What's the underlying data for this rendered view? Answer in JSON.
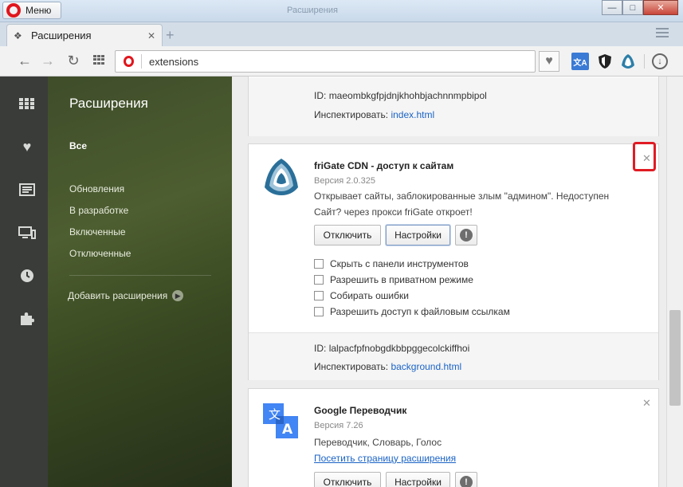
{
  "window": {
    "menu_label": "Меню",
    "title": "Расширения"
  },
  "tab": {
    "label": "Расширения"
  },
  "toolbar": {
    "address": "extensions"
  },
  "sidebar": {
    "title": "Расширения",
    "items": [
      {
        "label": "Все",
        "active": true
      },
      {
        "label": "Обновления"
      },
      {
        "label": "В разработке"
      },
      {
        "label": "Включенные"
      },
      {
        "label": "Отключенные"
      }
    ],
    "add_label": "Добавить расширения"
  },
  "cards": {
    "prev": {
      "id_label": "ID:",
      "id": "maeombkgfpjdnjkhohbjachnnmpbipol",
      "inspect_label": "Инспектировать:",
      "inspect_link": "index.html"
    },
    "frigate": {
      "name": "friGate CDN - доступ к сайтам",
      "version": "Версия 2.0.325",
      "description": "Открывает сайты, заблокированные злым \"админом\". Недоступен Сайт? через прокси friGate откроет!",
      "disable_label": "Отключить",
      "settings_label": "Настройки",
      "options": [
        "Скрыть с панели инструментов",
        "Разрешить в приватном режиме",
        "Собирать ошибки",
        "Разрешить доступ к файловым ссылкам"
      ],
      "id_label": "ID:",
      "id": "lalpacfpfnobgdkbbpggecolckiffhoi",
      "inspect_label": "Инспектировать:",
      "inspect_link": "background.html"
    },
    "translate": {
      "name": "Google Переводчик",
      "version": "Версия 7.26",
      "description": "Переводчик, Словарь, Голос",
      "visit_link": "Посетить страницу расширения",
      "disable_label": "Отключить",
      "settings_label": "Настройки"
    }
  },
  "colors": {
    "accent": "#1a63c6",
    "opera_red": "#e0161d",
    "highlight": "#e01b24"
  }
}
